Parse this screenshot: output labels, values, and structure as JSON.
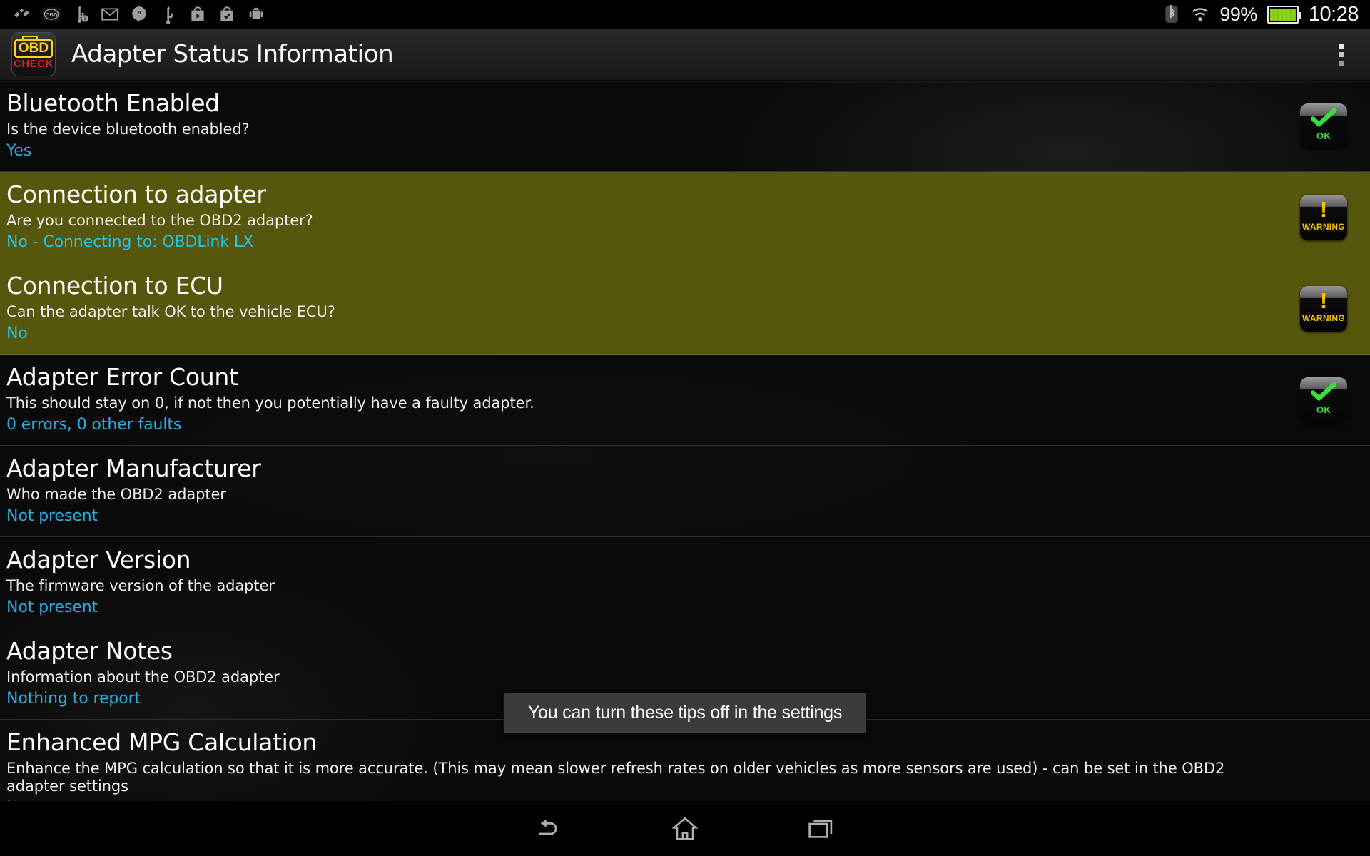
{
  "statusbar": {
    "left_icons": [
      "plug-icon",
      "obd-icon",
      "usb-debug-icon",
      "gmail-icon",
      "hangouts-icon",
      "usb-icon",
      "play-store-icon",
      "play-store-checked-icon",
      "android-icon"
    ],
    "bluetooth_icon": "bluetooth-icon",
    "wifi_icon": "wifi-icon",
    "battery_percent": "99%",
    "battery_icon": "battery-icon",
    "clock": "10:28"
  },
  "actionbar": {
    "app_icon": "obd-check-app-icon",
    "app_icon_text_top": "OBD",
    "app_icon_text_bottom": "CHECK",
    "title": "Adapter Status Information",
    "overflow_icon": "overflow-menu-icon"
  },
  "list": {
    "rows": [
      {
        "title": "Bluetooth Enabled",
        "desc": "Is the device bluetooth enabled?",
        "value": "Yes",
        "badge": "OK",
        "badge_type": "ok",
        "highlight": false
      },
      {
        "title": "Connection to adapter",
        "desc": "Are you connected to the OBD2 adapter?",
        "value": "No - Connecting to: OBDLink LX",
        "badge": "WARNING",
        "badge_type": "warning",
        "highlight": true
      },
      {
        "title": "Connection to ECU",
        "desc": "Can the adapter talk OK to the vehicle ECU?",
        "value": "No",
        "badge": "WARNING",
        "badge_type": "warning",
        "highlight": true
      },
      {
        "title": "Adapter Error Count",
        "desc": "This should stay on 0, if not then you potentially have a faulty adapter.",
        "value": "0 errors, 0 other faults",
        "badge": "OK",
        "badge_type": "ok",
        "highlight": false
      },
      {
        "title": "Adapter Manufacturer",
        "desc": "Who made the OBD2 adapter",
        "value": "Not present",
        "badge": "",
        "badge_type": "none",
        "highlight": false
      },
      {
        "title": "Adapter Version",
        "desc": "The firmware version of the adapter",
        "value": "Not present",
        "badge": "",
        "badge_type": "none",
        "highlight": false
      },
      {
        "title": "Adapter Notes",
        "desc": "Information about the OBD2 adapter",
        "value": "Nothing to report",
        "badge": "",
        "badge_type": "none",
        "highlight": false
      },
      {
        "title": "Enhanced MPG Calculation",
        "desc": "Enhance the MPG calculation so that it is more accurate. (This may mean slower refresh rates on older vehicles as more sensors are used) - can be set in the OBD2 adapter settings",
        "value": "No",
        "badge": "",
        "badge_type": "none",
        "highlight": false
      }
    ]
  },
  "toast": {
    "message": "You can turn these tips off in the settings"
  },
  "navbar": {
    "back_icon": "back-icon",
    "home_icon": "home-icon",
    "recents_icon": "recents-icon"
  },
  "colors": {
    "accent_value": "#2aaee0",
    "highlight_row": "#5d5d0e",
    "ok_green": "#3ddc3d",
    "warning_yellow": "#f5c400",
    "logo_yellow": "#ffd21e",
    "logo_red": "#e02020"
  }
}
